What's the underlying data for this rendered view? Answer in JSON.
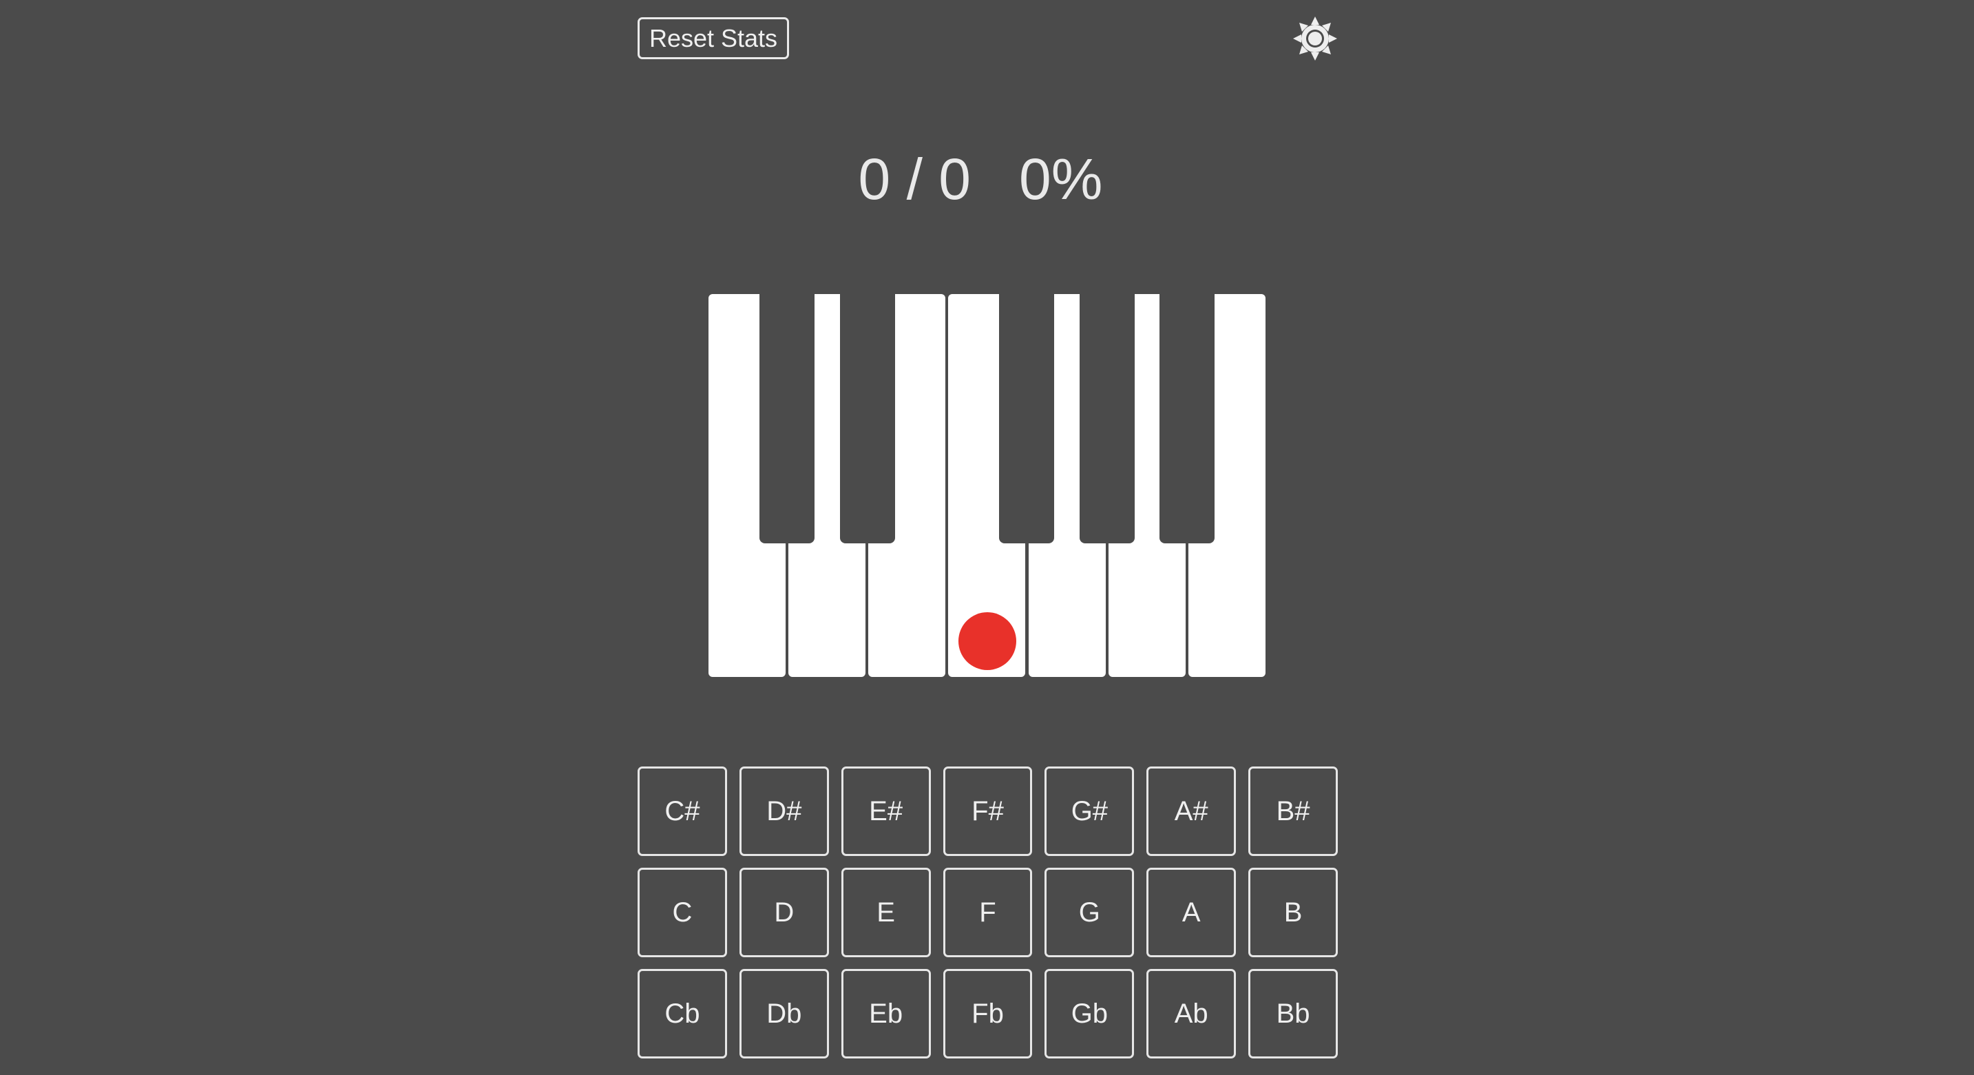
{
  "toolbar": {
    "reset_label": "Reset Stats",
    "settings_icon": "sun-gear-icon"
  },
  "score": {
    "correct": "0",
    "separator": "/",
    "total": "0",
    "percent": "0%"
  },
  "piano": {
    "white_keys": 7,
    "black_keys": 5,
    "highlighted_white_key_index": 3,
    "highlight_color": "#e8312a"
  },
  "answers": {
    "sharps": [
      "C#",
      "D#",
      "E#",
      "F#",
      "G#",
      "A#",
      "B#"
    ],
    "naturals": [
      "C",
      "D",
      "E",
      "F",
      "G",
      "A",
      "B"
    ],
    "flats": [
      "Cb",
      "Db",
      "Eb",
      "Fb",
      "Gb",
      "Ab",
      "Bb"
    ]
  },
  "colors": {
    "background": "#4b4b4b",
    "key_white": "#ffffff",
    "text": "#ececec"
  }
}
